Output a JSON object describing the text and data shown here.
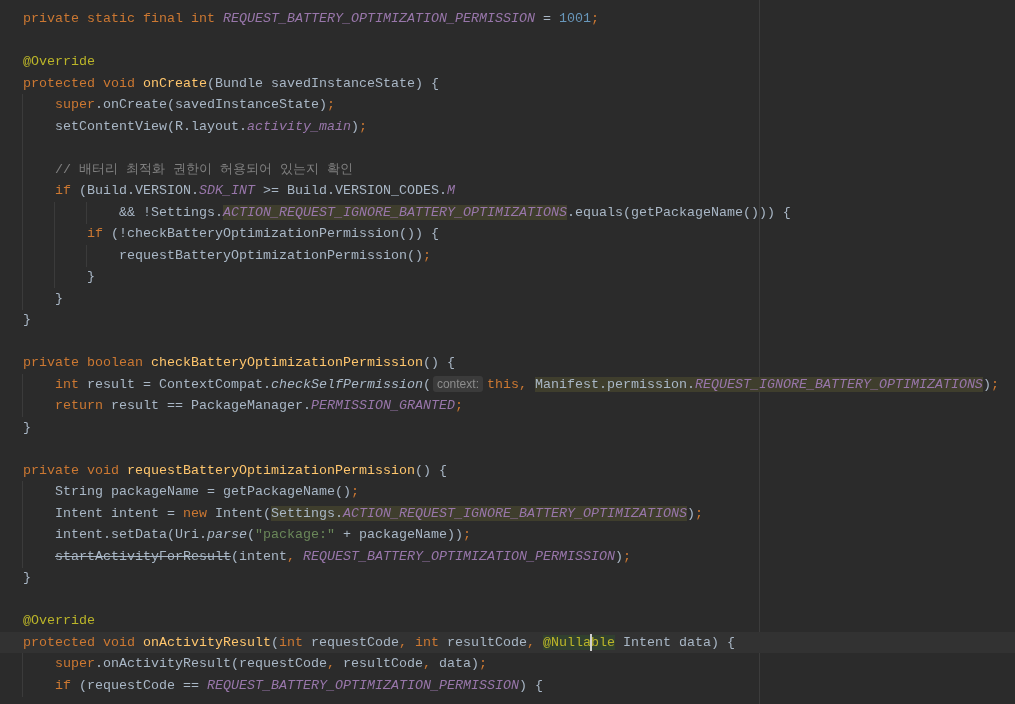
{
  "editor": {
    "lines": [
      {
        "kind": "code",
        "tokens": [
          {
            "text": "private static final int ",
            "kind": "keyword"
          },
          {
            "text": "REQUEST_BATTERY_OPTIMIZATION_PERMISSION",
            "kind": "constant"
          },
          {
            "text": " = ",
            "kind": "plain"
          },
          {
            "text": "1001",
            "kind": "number"
          },
          {
            "text": ";",
            "kind": "punct"
          }
        ]
      },
      {
        "kind": "blank"
      },
      {
        "kind": "code",
        "tokens": [
          {
            "text": "@Override",
            "kind": "annotation"
          }
        ]
      },
      {
        "kind": "code",
        "tokens": [
          {
            "text": "protected void ",
            "kind": "keyword"
          },
          {
            "text": "onCreate",
            "kind": "decl"
          },
          {
            "text": "(Bundle savedInstanceState) {",
            "kind": "plain"
          }
        ]
      },
      {
        "kind": "code",
        "tokens": [
          {
            "text": "    super",
            "kind": "keyword"
          },
          {
            "text": ".onCreate(savedInstanceState)",
            "kind": "plain"
          },
          {
            "text": ";",
            "kind": "punct"
          }
        ]
      },
      {
        "kind": "code",
        "tokens": [
          {
            "text": "    setContentView(R.layout.",
            "kind": "plain"
          },
          {
            "text": "activity_main",
            "kind": "constant"
          },
          {
            "text": ")",
            "kind": "plain"
          },
          {
            "text": ";",
            "kind": "punct"
          }
        ]
      },
      {
        "kind": "blank"
      },
      {
        "kind": "code",
        "tokens": [
          {
            "text": "    // 배터리 최적화 권한이 허용되어 있는지 확인",
            "kind": "comment"
          }
        ]
      },
      {
        "kind": "code",
        "tokens": [
          {
            "text": "    if",
            "kind": "keyword"
          },
          {
            "text": " (Build.VERSION.",
            "kind": "plain"
          },
          {
            "text": "SDK_INT",
            "kind": "constant"
          },
          {
            "text": " >= Build.VERSION_CODES.",
            "kind": "plain"
          },
          {
            "text": "M",
            "kind": "constant"
          }
        ]
      },
      {
        "kind": "code",
        "tokens": [
          {
            "text": "            && !Settings.",
            "kind": "plain"
          },
          {
            "kind": "warning",
            "tokens": [
              {
                "text": "ACTION_REQUEST_IGNORE_BATTERY_OPTIMIZATIONS",
                "kind": "constant"
              }
            ]
          },
          {
            "text": ".equals(getPackageName())) {",
            "kind": "plain"
          }
        ]
      },
      {
        "kind": "code",
        "tokens": [
          {
            "text": "        if",
            "kind": "keyword"
          },
          {
            "text": " (!checkBatteryOptimizationPermission()) {",
            "kind": "plain"
          }
        ]
      },
      {
        "kind": "code",
        "tokens": [
          {
            "text": "            requestBatteryOptimizationPermission()",
            "kind": "plain"
          },
          {
            "text": ";",
            "kind": "punct"
          }
        ]
      },
      {
        "kind": "code",
        "tokens": [
          {
            "text": "        }",
            "kind": "plain"
          }
        ]
      },
      {
        "kind": "code",
        "tokens": [
          {
            "text": "    }",
            "kind": "plain"
          }
        ]
      },
      {
        "kind": "code",
        "tokens": [
          {
            "text": "}",
            "kind": "plain"
          }
        ]
      },
      {
        "kind": "blank"
      },
      {
        "kind": "code",
        "tokens": [
          {
            "text": "private boolean ",
            "kind": "keyword"
          },
          {
            "text": "checkBatteryOptimizationPermission",
            "kind": "decl"
          },
          {
            "text": "() {",
            "kind": "plain"
          }
        ]
      },
      {
        "kind": "code",
        "tokens": [
          {
            "text": "    int",
            "kind": "keyword"
          },
          {
            "text": " result = ContextCompat.",
            "kind": "plain"
          },
          {
            "text": "checkSelfPermission",
            "kind": "static_call"
          },
          {
            "text": "(",
            "kind": "plain"
          },
          {
            "text": "context:",
            "kind": "hint"
          },
          {
            "text": "this",
            "kind": "keyword"
          },
          {
            "text": ", ",
            "kind": "punct"
          },
          {
            "kind": "warning",
            "tokens": [
              {
                "text": "Manifest.permission.",
                "kind": "plain"
              },
              {
                "text": "REQUEST_IGNORE_BATTERY_OPTIMIZATIONS",
                "kind": "constant"
              }
            ]
          },
          {
            "text": ")",
            "kind": "plain"
          },
          {
            "text": ";",
            "kind": "punct"
          }
        ]
      },
      {
        "kind": "code",
        "tokens": [
          {
            "text": "    return",
            "kind": "keyword"
          },
          {
            "text": " result == PackageManager.",
            "kind": "plain"
          },
          {
            "text": "PERMISSION_GRANTED",
            "kind": "constant"
          },
          {
            "text": ";",
            "kind": "punct"
          }
        ]
      },
      {
        "kind": "code",
        "tokens": [
          {
            "text": "}",
            "kind": "plain"
          }
        ]
      },
      {
        "kind": "blank"
      },
      {
        "kind": "code",
        "tokens": [
          {
            "text": "private void ",
            "kind": "keyword"
          },
          {
            "text": "requestBatteryOptimizationPermission",
            "kind": "decl"
          },
          {
            "text": "() {",
            "kind": "plain"
          }
        ]
      },
      {
        "kind": "code",
        "tokens": [
          {
            "text": "    String packageName = getPackageName()",
            "kind": "plain"
          },
          {
            "text": ";",
            "kind": "punct"
          }
        ]
      },
      {
        "kind": "code",
        "tokens": [
          {
            "text": "    Intent intent = ",
            "kind": "plain"
          },
          {
            "text": "new",
            "kind": "keyword"
          },
          {
            "text": " Intent(",
            "kind": "plain"
          },
          {
            "kind": "warning",
            "tokens": [
              {
                "text": "Settings.",
                "kind": "plain"
              },
              {
                "text": "ACTION_REQUEST_IGNORE_BATTERY_OPTIMIZATIONS",
                "kind": "constant"
              }
            ]
          },
          {
            "text": ")",
            "kind": "plain"
          },
          {
            "text": ";",
            "kind": "punct"
          }
        ]
      },
      {
        "kind": "code",
        "tokens": [
          {
            "text": "    intent.setData(Uri.",
            "kind": "plain"
          },
          {
            "text": "parse",
            "kind": "static_call"
          },
          {
            "text": "(",
            "kind": "plain"
          },
          {
            "text": "\"package:\"",
            "kind": "string"
          },
          {
            "text": " + packageName))",
            "kind": "plain"
          },
          {
            "text": ";",
            "kind": "punct"
          }
        ]
      },
      {
        "kind": "code",
        "tokens": [
          {
            "text": "    startActivityForResult",
            "kind": "deprecated"
          },
          {
            "text": "(intent",
            "kind": "plain"
          },
          {
            "text": ", ",
            "kind": "punct"
          },
          {
            "text": "REQUEST_BATTERY_OPTIMIZATION_PERMISSION",
            "kind": "constant"
          },
          {
            "text": ")",
            "kind": "plain"
          },
          {
            "text": ";",
            "kind": "punct"
          }
        ]
      },
      {
        "kind": "code",
        "tokens": [
          {
            "text": "}",
            "kind": "plain"
          }
        ]
      },
      {
        "kind": "blank"
      },
      {
        "kind": "code",
        "tokens": [
          {
            "text": "@Override",
            "kind": "annotation"
          }
        ]
      },
      {
        "kind": "code",
        "tokens": [
          {
            "text": "protected void ",
            "kind": "keyword"
          },
          {
            "text": "onActivityResult",
            "kind": "decl"
          },
          {
            "text": "(",
            "kind": "plain"
          },
          {
            "text": "int",
            "kind": "keyword"
          },
          {
            "text": " requestCode",
            "kind": "plain"
          },
          {
            "text": ", ",
            "kind": "punct"
          },
          {
            "text": "int",
            "kind": "keyword"
          },
          {
            "text": " resultCode",
            "kind": "plain"
          },
          {
            "text": ", ",
            "kind": "punct"
          },
          {
            "kind": "usage",
            "tokens": [
              {
                "text": "@Nulla",
                "kind": "annotation"
              },
              {
                "kind": "caret"
              },
              {
                "text": "ble",
                "kind": "annotation"
              }
            ]
          },
          {
            "text": " Intent data) {",
            "kind": "plain"
          }
        ]
      },
      {
        "kind": "code",
        "tokens": [
          {
            "text": "    super",
            "kind": "keyword"
          },
          {
            "text": ".onActivityResult(requestCode",
            "kind": "plain"
          },
          {
            "text": ",",
            "kind": "punct"
          },
          {
            "text": " resultCode",
            "kind": "plain"
          },
          {
            "text": ",",
            "kind": "punct"
          },
          {
            "text": " data)",
            "kind": "plain"
          },
          {
            "text": ";",
            "kind": "punct"
          }
        ]
      },
      {
        "kind": "code",
        "tokens": [
          {
            "text": "    if",
            "kind": "keyword"
          },
          {
            "text": " (requestCode == ",
            "kind": "plain"
          },
          {
            "text": "REQUEST_BATTERY_OPTIMIZATION_PERMISSION",
            "kind": "constant"
          },
          {
            "text": ") {",
            "kind": "plain"
          }
        ]
      }
    ]
  }
}
